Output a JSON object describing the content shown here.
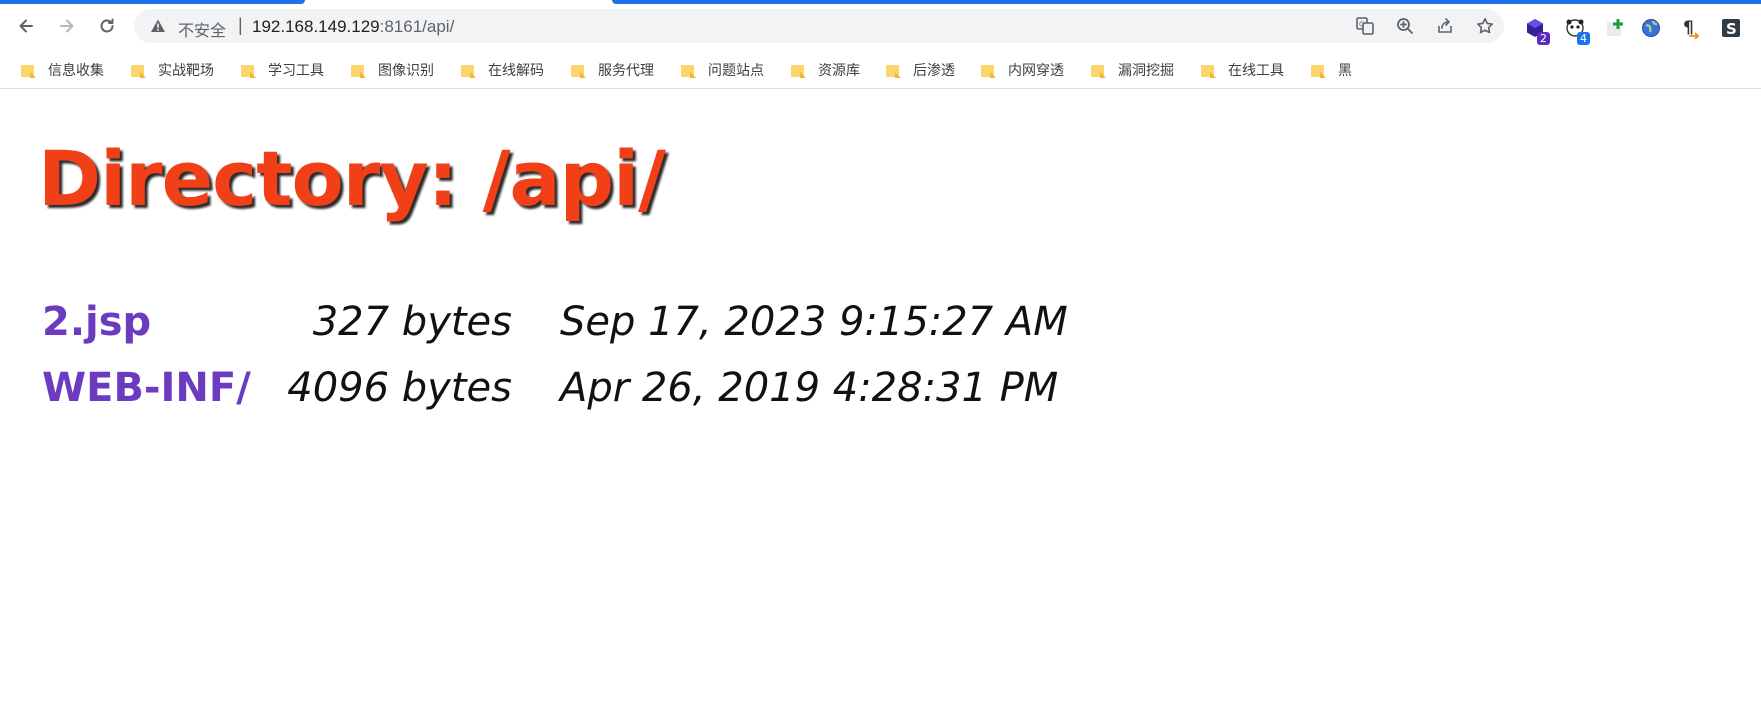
{
  "browser": {
    "security_label": "不安全",
    "url_host": "192.168.149.129",
    "url_port": ":8161",
    "url_path": "/api/",
    "extensions": [
      {
        "icon": "extension-cube-icon",
        "badge": "2",
        "badge_color": "#5b2bbf"
      },
      {
        "icon": "extension-panda-icon",
        "badge": "4",
        "badge_color": "#1a73e8"
      },
      {
        "icon": "extension-plus-icon"
      },
      {
        "icon": "extension-globe-icon"
      },
      {
        "icon": "extension-paragraph-icon"
      },
      {
        "icon": "extension-s-icon"
      }
    ]
  },
  "bookmarks": [
    {
      "label": "信息收集"
    },
    {
      "label": "实战靶场"
    },
    {
      "label": "学习工具"
    },
    {
      "label": "图像识别"
    },
    {
      "label": "在线解码"
    },
    {
      "label": "服务代理"
    },
    {
      "label": "问题站点"
    },
    {
      "label": "资源库"
    },
    {
      "label": "后渗透"
    },
    {
      "label": "内网穿透"
    },
    {
      "label": "漏洞挖掘"
    },
    {
      "label": "在线工具"
    },
    {
      "label": "黑"
    }
  ],
  "page": {
    "title": "Directory: /api/",
    "title_color": "#f13f17",
    "link_color": "#6c3bc0",
    "entries": [
      {
        "name": "2.jsp",
        "size": "327 bytes",
        "date": "Sep 17, 2023 9:15:27 AM"
      },
      {
        "name": "WEB-INF/",
        "size": "4096 bytes",
        "date": "Apr 26, 2019 4:28:31 PM"
      }
    ]
  }
}
